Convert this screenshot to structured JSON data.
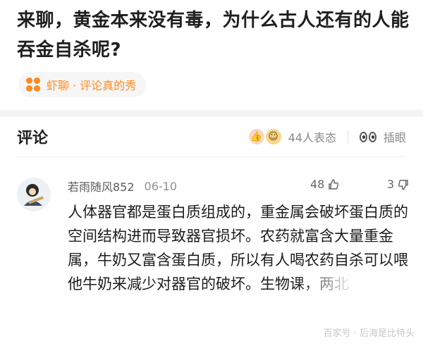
{
  "post": {
    "title": "来聊，黄金本来没有毒，为什么古人还有的人能吞金自杀呢?"
  },
  "topic": {
    "icon": "bubble-cluster-icon",
    "label": "虾聊 · 评论真的秀",
    "accent": "#ff8a1f"
  },
  "comments_header": {
    "title": "评论",
    "reaction_count_label": "44人表态",
    "insert_label": "插眼"
  },
  "comment": {
    "username": "若雨随风852",
    "date": "06-10",
    "likes": "48",
    "dislikes": "3",
    "body": "人体器官都是蛋白质组成的，重金属会破坏蛋白质的空间结构进而导致器官损坏。农药就富含大量重金属，牛奶又富含蛋白质，所以有人喝农药自杀可以喂他牛奶来减少对器官的破坏。生物课，两北"
  },
  "watermark": {
    "text": "百家号 · 后海是比特头"
  }
}
